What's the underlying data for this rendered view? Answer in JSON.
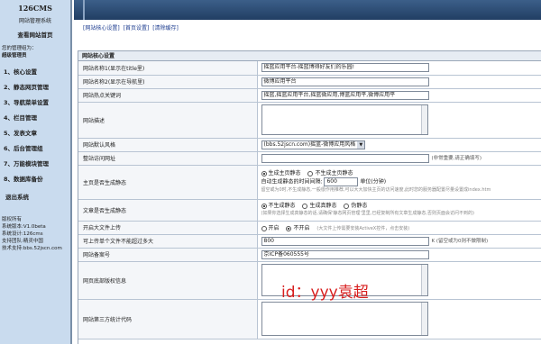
{
  "sidebar": {
    "title": "126CMS",
    "subtitle": "网站管理系统",
    "home_link": "查看网站首页",
    "user_label": "您的管理组为：",
    "user_role": "超级管理员",
    "menu": [
      {
        "label": "1、核心设置"
      },
      {
        "label": "2、静态网页管理"
      },
      {
        "label": "3、导航菜单设置"
      },
      {
        "label": "4、栏目管理"
      },
      {
        "label": "5、发表文章"
      },
      {
        "label": "6、后台管理组"
      },
      {
        "label": "7、万能模块管理"
      },
      {
        "label": "8、数据库备份"
      }
    ],
    "logout": "退出系统",
    "info": {
      "copyright": "版权所有",
      "version": "系统版本:V1.0beta",
      "design": "系统设计:126cms",
      "support": "支持团队:精灵中国",
      "tech": "技术支持:bbs.52jscn.com"
    }
  },
  "tabs": [
    {
      "label": "[网站核心设置]"
    },
    {
      "label": "[首页设置]"
    },
    {
      "label": "[清除缓存]"
    }
  ],
  "panel": {
    "title": "网站核心设置",
    "rows": {
      "site_name_title": {
        "label": "网站名称1(显示在title里)",
        "value": "摇篮应用平台-摇篮博得好友们的乐园!"
      },
      "site_name_nav": {
        "label": "网站名称2(显示在导航里)",
        "value": "微博应用平台"
      },
      "keywords": {
        "label": "网站热点关键词",
        "value": "摇篮,摇篮应用平台,摇篮微应用,博篮应用平,微博应用平"
      },
      "description": {
        "label": "网站描述",
        "value": ""
      },
      "default_style": {
        "label": "网站默认风格",
        "value": "(bbs.52jscn.com)摇篮-微博应用风格"
      },
      "site_url": {
        "label": "整站访问网址",
        "value": "",
        "hint": "(非常重要,请正确填写)"
      },
      "home_static": {
        "label": "主页是否生成静态",
        "option_on": "生成主页静态",
        "option_off": "不生成主页静态",
        "interval_label": "自动生成静态的时间间隔:",
        "interval_value": "600",
        "interval_unit": "单位(分钟)",
        "note": "留空或为0时,不生成静态,一般很作用推荐,可以大大加快主页的访问速度,此时您的服务器配置尽量设置成index.htm"
      },
      "article_static": {
        "label": "文章是否生成静态",
        "option_off": "不生成静态",
        "option_on": "生成真静态",
        "option_fake": "伪静态",
        "note": "(如果你选择生成真静态的话,请确保'静态网页管理'里里,已经复制所有文章生成静态,否则页面会访问不到的)"
      },
      "bigfile_upload": {
        "label": "开启大文件上传",
        "option_on": "开启",
        "option_off": "不开启",
        "note": "(大文件上传需要安装ActiveX控件，点击安装)"
      },
      "upload_limit": {
        "label": "可上传单个文件不能超过多大",
        "value": "800",
        "hint": "K (留空或为0则不做限制)"
      },
      "icp": {
        "label": "网站备案号",
        "value": "京ICP备060555号"
      },
      "footer_copyright": {
        "label": "网页底部版权信息",
        "value": ""
      },
      "stats_code": {
        "label": "网站第三方统计代码",
        "value": ""
      }
    }
  },
  "watermark": "id：yyy袁超"
}
